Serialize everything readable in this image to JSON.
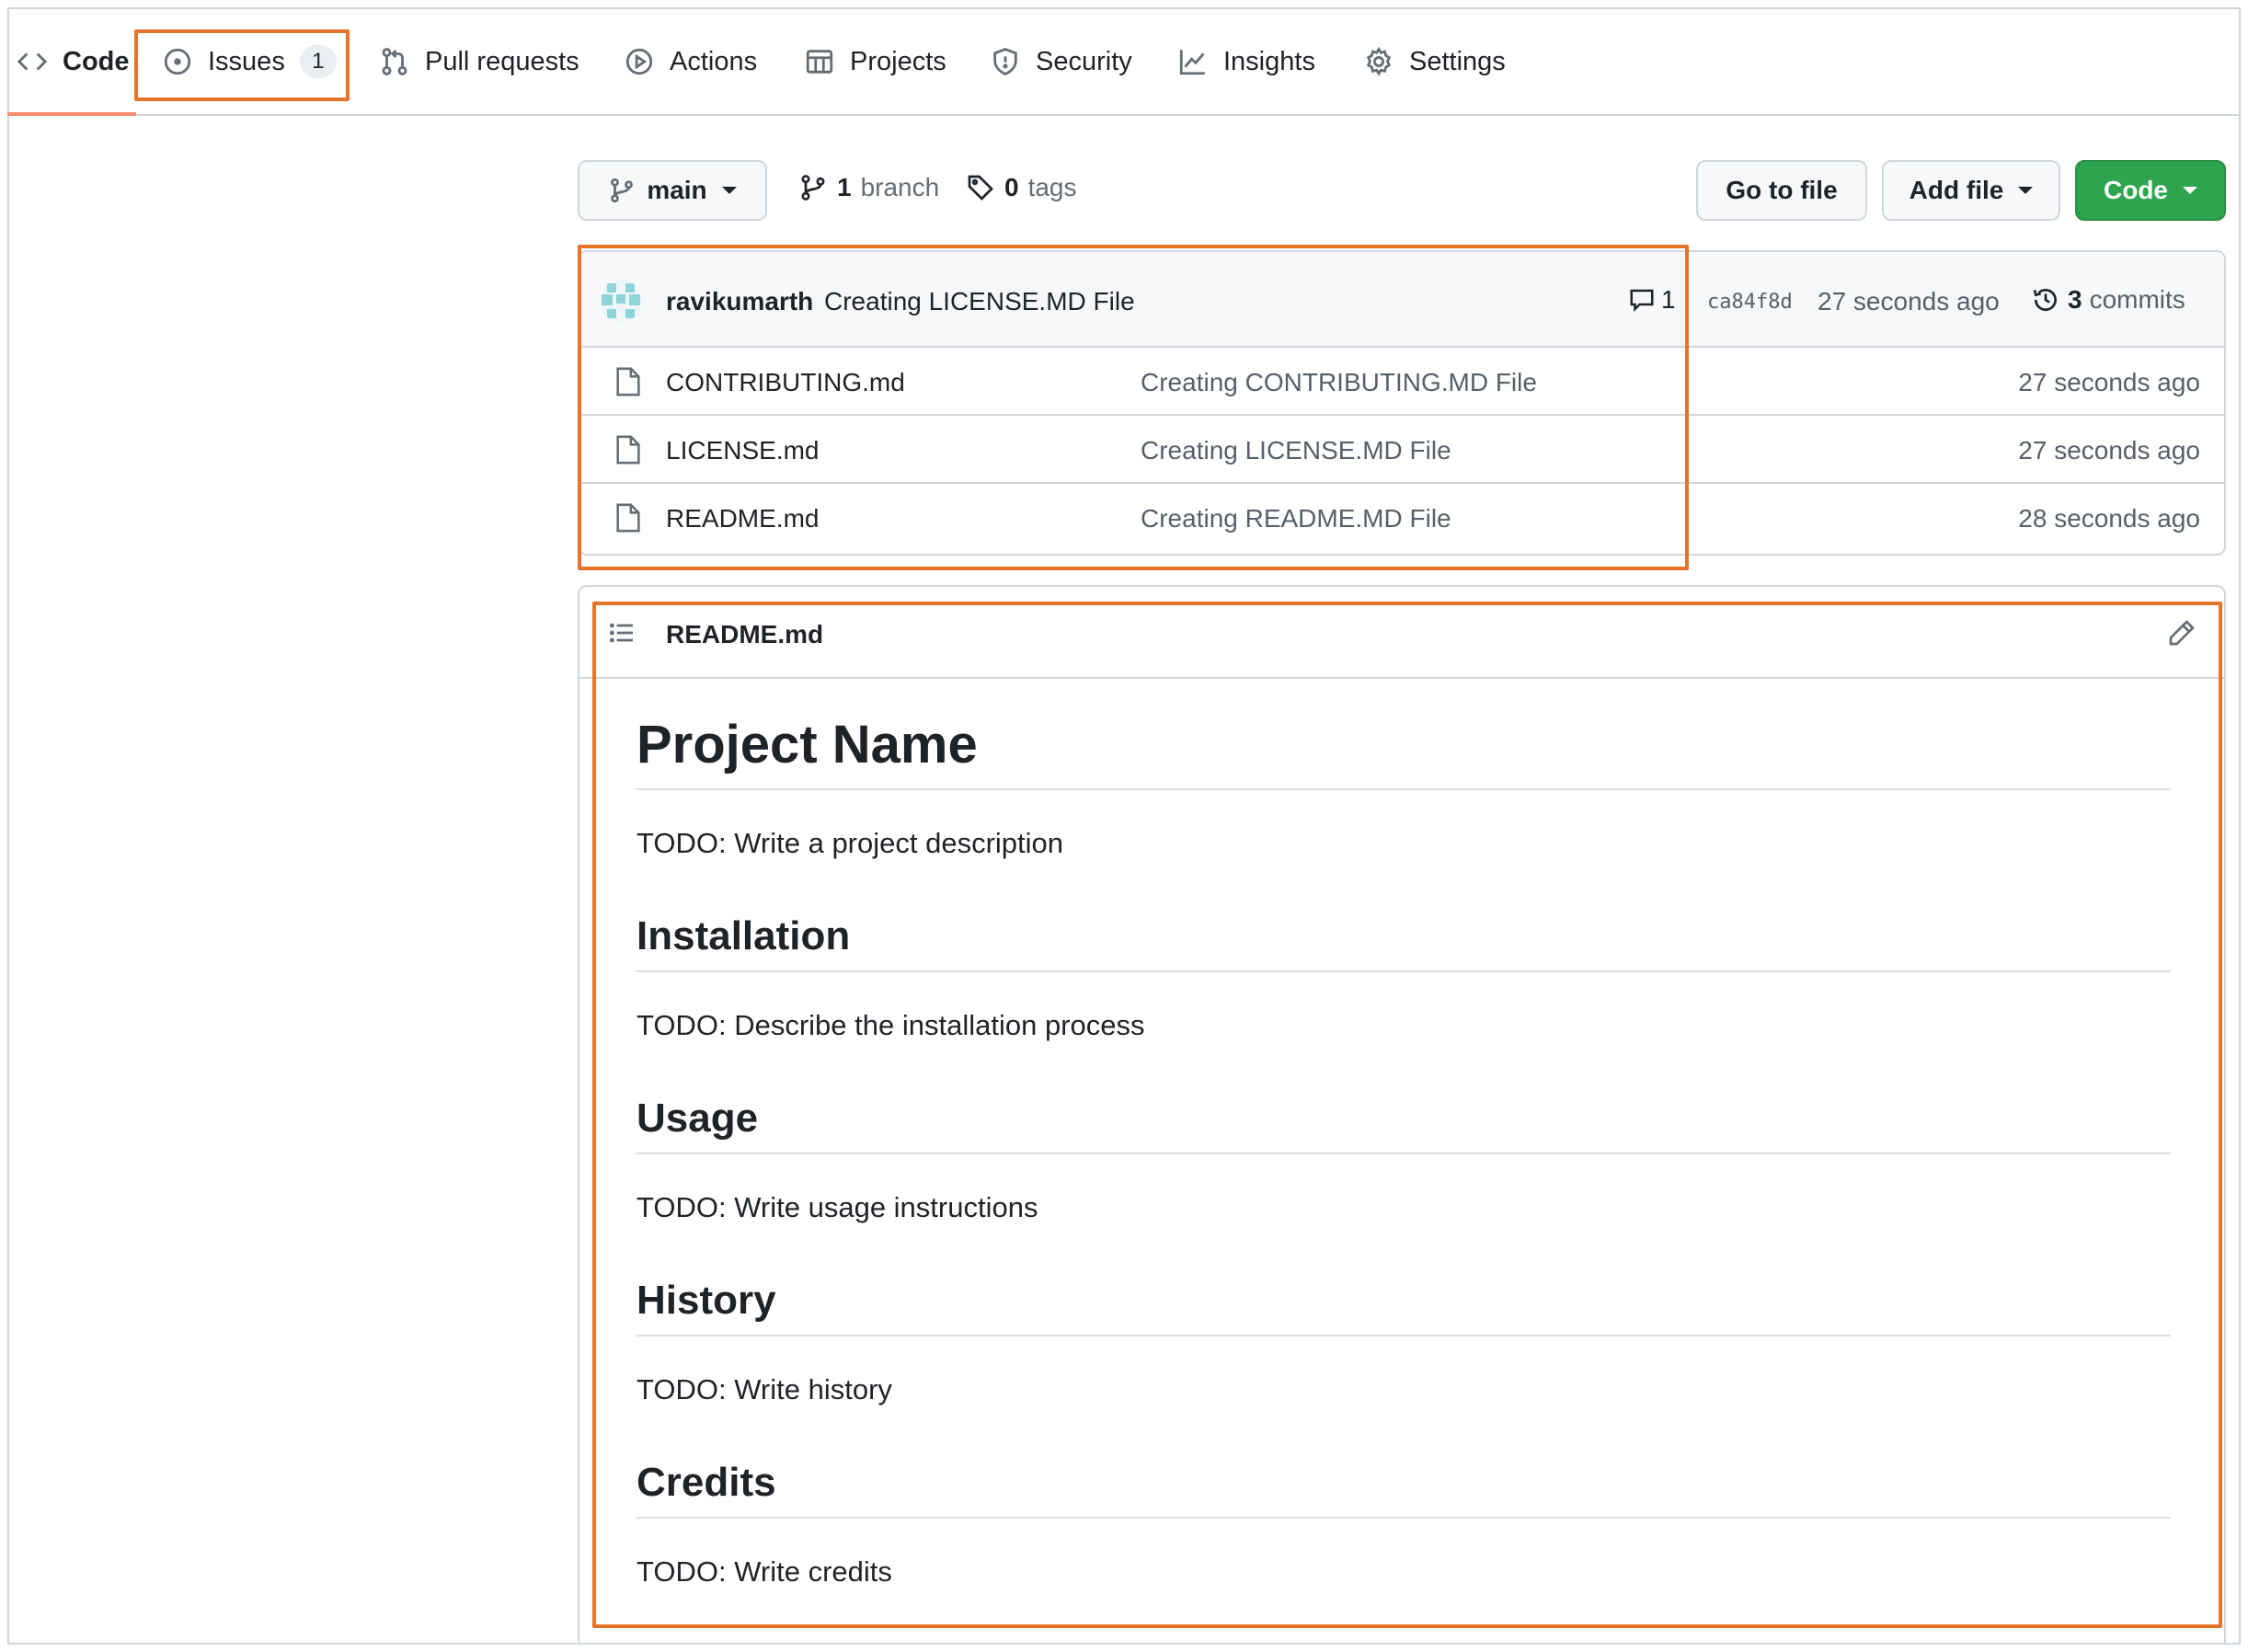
{
  "nav": {
    "tabs": [
      {
        "label": "Code",
        "icon": "code-icon",
        "active": true
      },
      {
        "label": "Issues",
        "icon": "issue-opened-icon",
        "count": "1"
      },
      {
        "label": "Pull requests",
        "icon": "git-pull-request-icon"
      },
      {
        "label": "Actions",
        "icon": "play-icon"
      },
      {
        "label": "Projects",
        "icon": "table-icon"
      },
      {
        "label": "Security",
        "icon": "shield-icon"
      },
      {
        "label": "Insights",
        "icon": "graph-icon"
      },
      {
        "label": "Settings",
        "icon": "gear-icon"
      }
    ]
  },
  "toolbar": {
    "branch_selector": "main",
    "branches_count": "1",
    "branches_label": "branch",
    "tags_count": "0",
    "tags_label": "tags",
    "go_to_file": "Go to file",
    "add_file": "Add file",
    "code": "Code"
  },
  "commit": {
    "author": "ravikumarth",
    "message": "Creating LICENSE.MD File",
    "comments": "1",
    "sha": "ca84f8d",
    "time": "27 seconds ago",
    "commits_count": "3",
    "commits_label": "commits"
  },
  "files": [
    {
      "name": "CONTRIBUTING.md",
      "message": "Creating CONTRIBUTING.MD File",
      "age": "27 seconds ago"
    },
    {
      "name": "LICENSE.md",
      "message": "Creating LICENSE.MD File",
      "age": "27 seconds ago"
    },
    {
      "name": "README.md",
      "message": "Creating README.MD File",
      "age": "28 seconds ago"
    }
  ],
  "readme": {
    "filename": "README.md",
    "title": "Project Name",
    "intro": "TODO: Write a project description",
    "sections": [
      {
        "heading": "Installation",
        "text": "TODO: Describe the installation process"
      },
      {
        "heading": "Usage",
        "text": "TODO: Write usage instructions"
      },
      {
        "heading": "History",
        "text": "TODO: Write history"
      },
      {
        "heading": "Credits",
        "text": "TODO: Write credits"
      }
    ]
  },
  "colors": {
    "highlight": "#e8742a",
    "primary_button": "#2da44e",
    "active_tab_underline": "#fd8c73"
  }
}
